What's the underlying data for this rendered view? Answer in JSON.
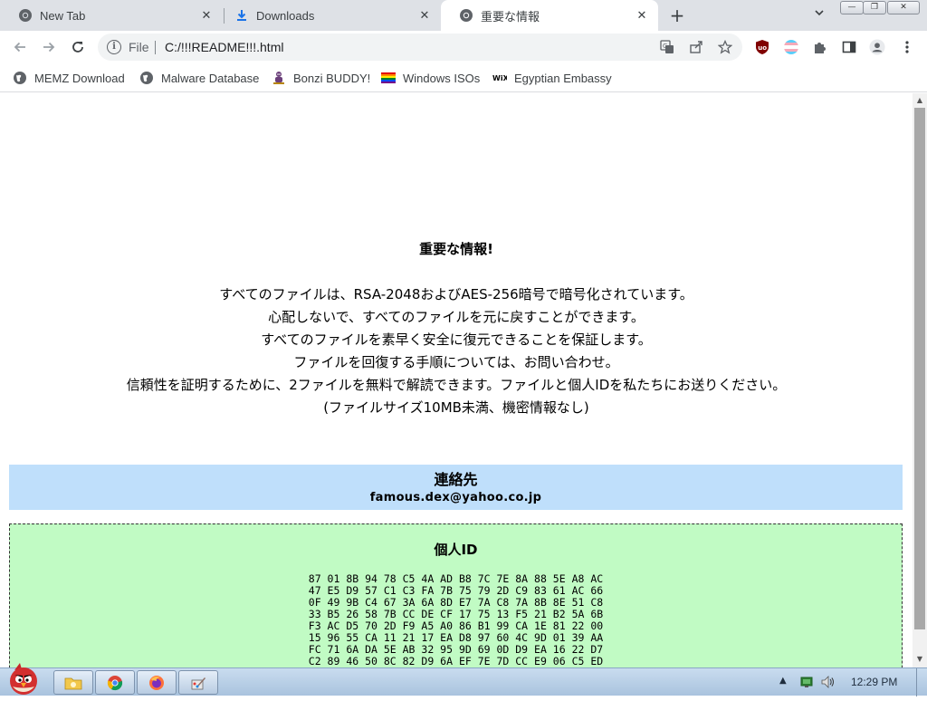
{
  "tabs": [
    {
      "label": "New Tab",
      "icon": "chrome-icon"
    },
    {
      "label": "Downloads",
      "icon": "download-icon"
    },
    {
      "label": "重要な情報",
      "icon": "chrome-icon"
    }
  ],
  "toolbar": {
    "scheme": "File",
    "url": "C:/!!!README!!!.html"
  },
  "bookmarks": [
    {
      "label": "MEMZ Download",
      "icon": "globe-icon"
    },
    {
      "label": "Malware Database",
      "icon": "globe-icon"
    },
    {
      "label": "Bonzi BUDDY!",
      "icon": "bonzi-icon"
    },
    {
      "label": "Windows ISOs",
      "icon": "rainbow-flag-icon"
    },
    {
      "label": "Egyptian Embassy",
      "icon": "wix-icon"
    }
  ],
  "page": {
    "heading": "重要な情報!",
    "message_lines": [
      "すべてのファイルは、RSA-2048およびAES-256暗号で暗号化されています。",
      "心配しないで、すべてのファイルを元に戻すことができます。",
      "すべてのファイルを素早く安全に復元できることを保証します。",
      "ファイルを回復する手順については、お問い合わせ。",
      "信頼性を証明するために、2ファイルを無料で解読できます。ファイルと個人IDを私たちにお送りください。",
      "(ファイルサイズ10MB未満、機密情報なし)"
    ],
    "contact": {
      "title": "連絡先",
      "email": "famous.dex@yahoo.co.jp"
    },
    "personal_id": {
      "title": "個人ID",
      "hex_lines": [
        "87 01 8B 94 78 C5 4A AD B8 7C 7E 8A 88 5E A8 AC",
        "47 E5 D9 57 C1 C3 FA 7B 75 79 2D C9 83 61 AC 66",
        "0F 49 9B C4 67 3A 6A 8D E7 7A C8 7A 8B 8E 51 C8",
        "33 B5 26 58 7B CC DE CF 17 75 13 F5 21 B2 5A 6B",
        "F3 AC D5 70 2D F9 A5 A0 86 B1 99 CA 1E 81 22 00",
        "15 96 55 CA 11 21 17 EA D8 97 60 4C 9D 01 39 AA",
        "FC 71 6A DA 5E AB 32 95 9D 69 0D D9 EA 16 22 D7",
        "C2 89 46 50 8C 82 D9 6A EF 7E 7D CC E9 06 C5 ED"
      ]
    }
  },
  "taskbar": {
    "clock": "12:29 PM"
  },
  "colors": {
    "contact_bg": "#bfdffb",
    "id_bg": "#c1fbc4",
    "tab_strip": "#dee1e6",
    "ublock_red": "#800000"
  }
}
